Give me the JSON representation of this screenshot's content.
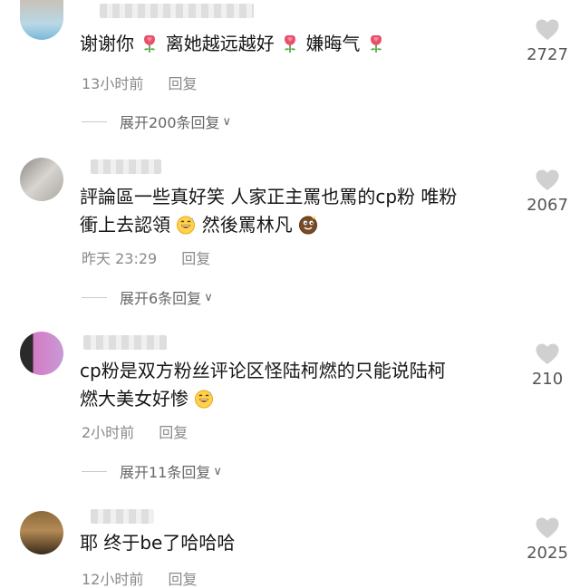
{
  "comments": [
    {
      "text_parts": [
        "谢谢你",
        "离她越远越好",
        "嫌晦气"
      ],
      "time": "13小时前",
      "reply_label": "回复",
      "thread_label": "展开200条回复",
      "likes": "2727"
    },
    {
      "text_line1": "評論區一些真好笑 人家正主罵也罵的cp粉 唯粉",
      "text_line2a": "衝上去認領",
      "text_line2b": "然後罵林凡",
      "time": "昨天 23:29",
      "reply_label": "回复",
      "thread_label": "展开6条回复",
      "likes": "2067"
    },
    {
      "text_line1": "cp粉是双方粉丝评论区怪陆柯燃的只能说陆柯",
      "text_line2": "燃大美女好惨",
      "time": "2小时前",
      "reply_label": "回复",
      "thread_label": "展开11条回复",
      "likes": "210"
    },
    {
      "text": "耶 终于be了哈哈哈",
      "time": "12小时前",
      "reply_label": "回复",
      "likes": "2025"
    }
  ],
  "icons": {
    "like": "heart-icon",
    "rose": "rose-emoji-icon",
    "sweat_smile": "sweat-smile-emoji-icon",
    "smirk": "smirk-emoji-icon",
    "chevron": "chevron-down-icon"
  },
  "colors": {
    "text": "#161616",
    "meta": "#8a8a8a",
    "heart": "#d0d0d0"
  }
}
